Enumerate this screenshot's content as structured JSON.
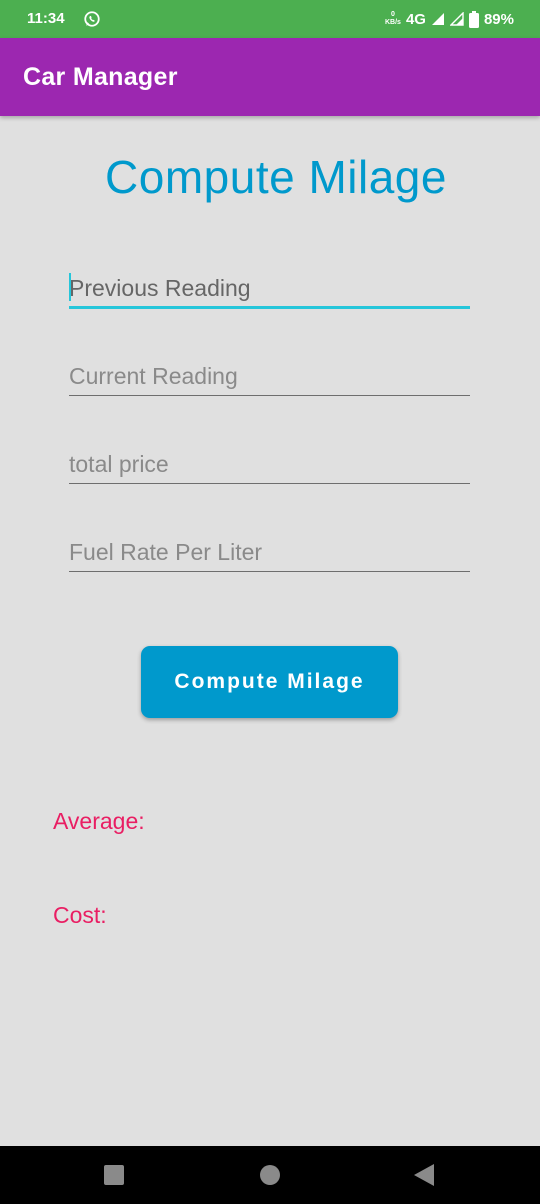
{
  "status_bar": {
    "time": "11:34",
    "data_speed_value": "0",
    "data_speed_unit": "KB/s",
    "network": "4G",
    "battery": "89%",
    "icons": [
      "whatsapp-icon",
      "signal-icon",
      "battery-icon"
    ]
  },
  "app_bar": {
    "title": "Car Manager",
    "color": "#9c27b0"
  },
  "main": {
    "title": "Compute Milage",
    "fields": [
      {
        "placeholder": "Previous Reading",
        "value": "",
        "focused": true
      },
      {
        "placeholder": "Current Reading",
        "value": "",
        "focused": false
      },
      {
        "placeholder": "total price",
        "value": "",
        "focused": false
      },
      {
        "placeholder": "Fuel Rate Per Liter",
        "value": "",
        "focused": false
      }
    ],
    "compute_button_label": "Compute Milage",
    "results": {
      "average_label": "Average:",
      "cost_label": "Cost:"
    }
  },
  "nav_bar": {
    "icons": [
      "recents-icon",
      "home-icon",
      "back-icon"
    ]
  },
  "colors": {
    "status_bar": "#4caf50",
    "accent": "#0099cc",
    "focus_line": "#26c6da",
    "result_text": "#e91e63",
    "background": "#e0e0e0"
  }
}
